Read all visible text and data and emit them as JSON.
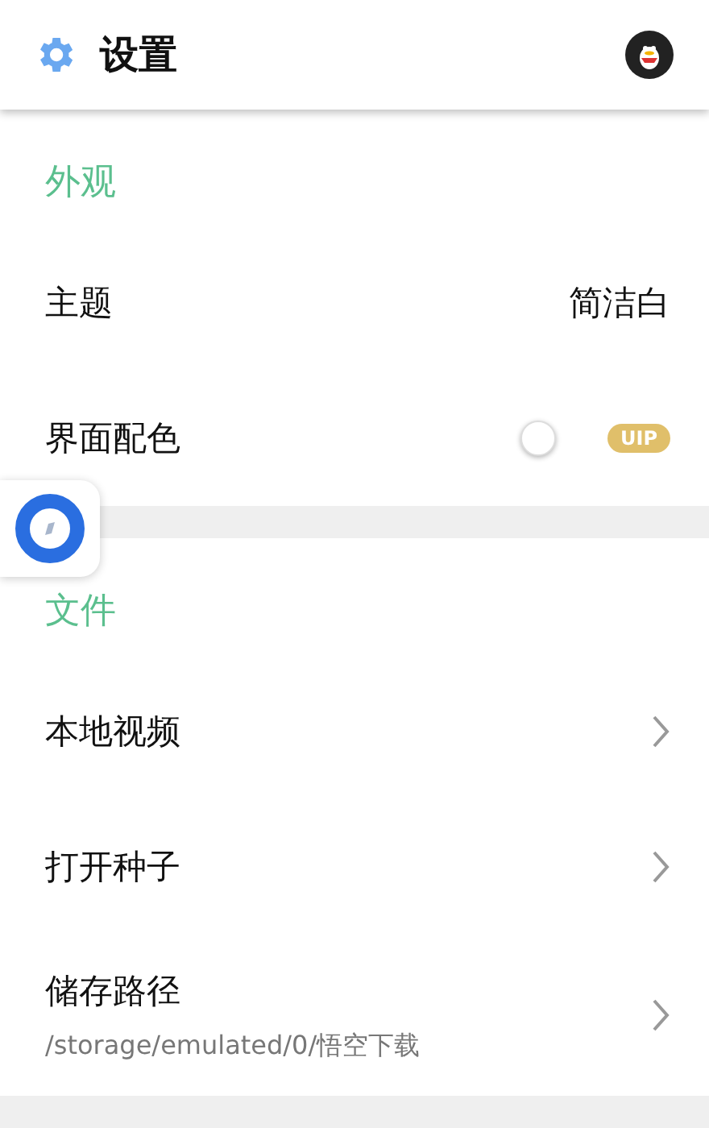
{
  "header": {
    "title": "设置"
  },
  "sections": [
    {
      "title": "外观",
      "rows": [
        {
          "kind": "value",
          "label": "主题",
          "value": "简洁白"
        },
        {
          "kind": "switch",
          "label": "界面配色",
          "on": false,
          "badge": "UIP"
        }
      ]
    },
    {
      "title": "文件",
      "rows": [
        {
          "kind": "link",
          "label": "本地视频"
        },
        {
          "kind": "link",
          "label": "打开种子"
        },
        {
          "kind": "link",
          "label": "储存路径",
          "subtitle": "/storage/emulated/0/悟空下载"
        }
      ]
    }
  ]
}
